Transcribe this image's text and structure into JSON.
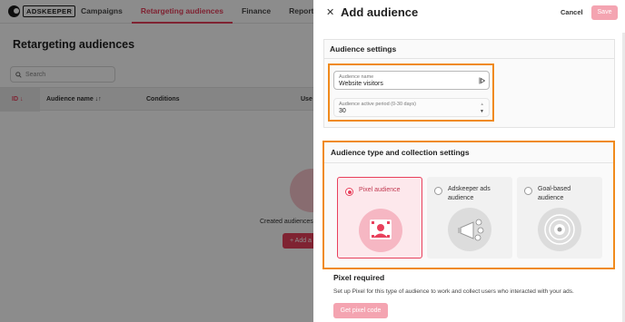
{
  "background": {
    "logo_text": "ADSKEEPER",
    "nav": [
      "Campaigns",
      "Retargeting audiences",
      "Finance",
      "Reports"
    ],
    "active_nav": "Retargeting audiences",
    "page_title": "Retargeting audiences",
    "search_placeholder": "Search",
    "table_headers": {
      "id": "ID ↓",
      "name": "Audience name ↓↑",
      "conditions": "Conditions",
      "users": "Use"
    },
    "empty_text": "Created audiences",
    "empty_button": "+ Add a"
  },
  "drawer": {
    "title": "Add audience",
    "cancel": "Cancel",
    "save": "Save",
    "settings": {
      "heading": "Audience settings",
      "name_label": "Audience name",
      "name_value": "Website visitors",
      "period_label": "Audience active period (0-30 days)",
      "period_value": "30"
    },
    "type_section": {
      "heading": "Audience type and collection settings",
      "options": [
        {
          "label": "Pixel audience",
          "selected": true,
          "icon": "pixel-illustration"
        },
        {
          "label": "Adskeeper ads audience",
          "selected": false,
          "icon": "megaphone-illustration"
        },
        {
          "label": "Goal-based audience",
          "selected": false,
          "icon": "target-illustration"
        }
      ]
    },
    "pixel": {
      "title": "Pixel required",
      "description": "Set up Pixel for this type of audience to work and collect users who interacted with your ads.",
      "button": "Get pixel code"
    }
  },
  "colors": {
    "accent": "#e8405c",
    "highlight": "#f08a1c"
  }
}
